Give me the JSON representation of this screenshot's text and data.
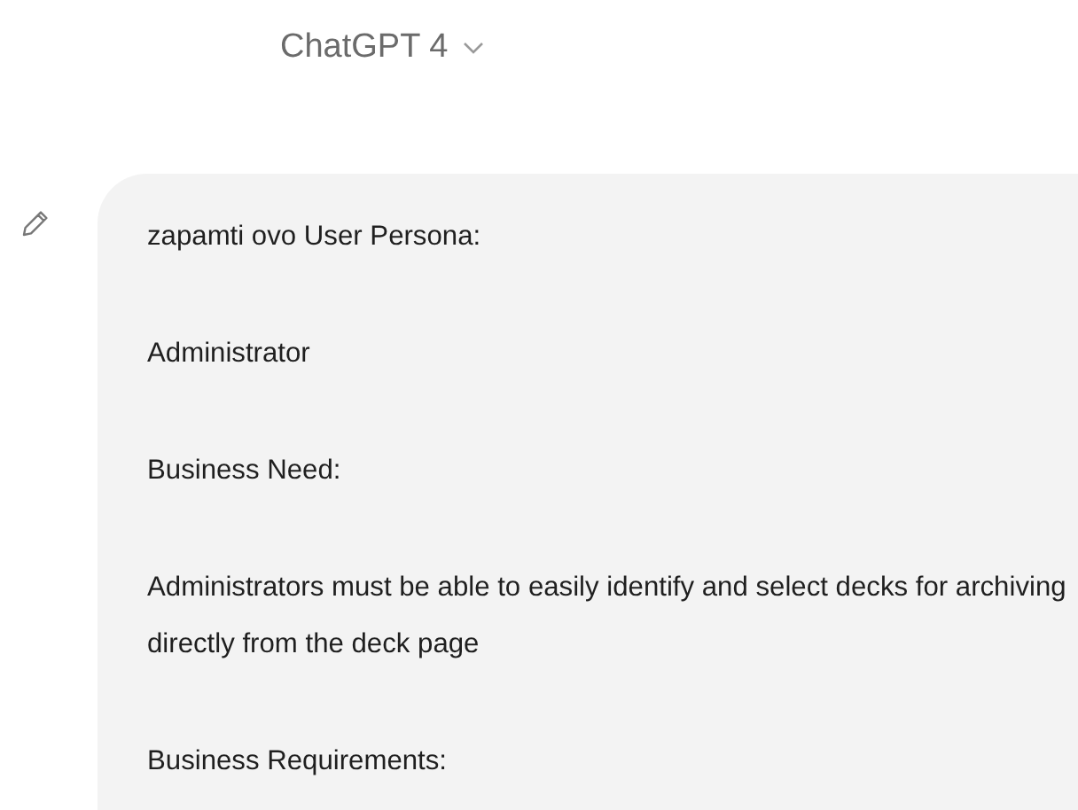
{
  "header": {
    "model": "ChatGPT 4"
  },
  "message": {
    "paragraphs": [
      "zapamti ovo User Persona:",
      "Administrator",
      "Business Need:",
      "Administrators must be able to easily identify and select decks for archiving directly from the deck page",
      "Business Requirements:"
    ]
  }
}
